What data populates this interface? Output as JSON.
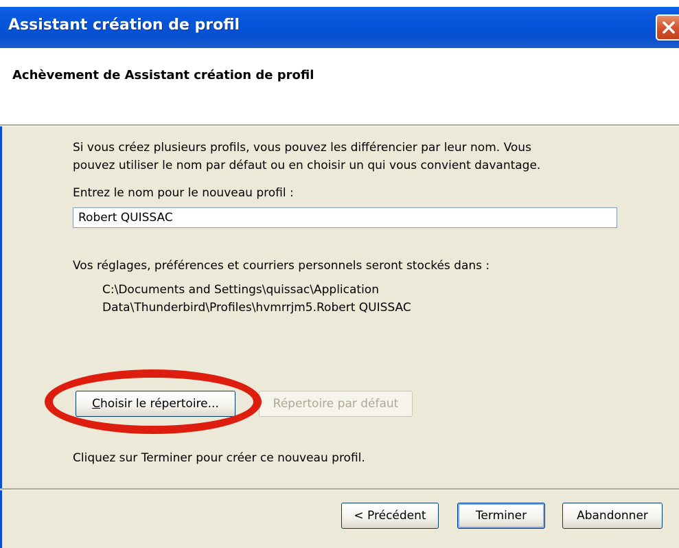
{
  "window": {
    "title": "Assistant création de profil"
  },
  "header": {
    "title": "Achèvement de Assistant création de profil"
  },
  "body": {
    "description_line1": "Si vous créez plusieurs profils, vous pouvez les différencier par leur nom. Vous",
    "description_line2": "pouvez utiliser le nom par défaut ou en choisir un qui vous convient davantage.",
    "name_label": "Entrez le nom pour le nouveau profil :",
    "name_value": "Robert QUISSAC",
    "storage_label": "Vos réglages, préférences et courriers personnels seront stockés dans :",
    "storage_path_line1": "C:\\Documents and Settings\\quissac\\Application",
    "storage_path_line2": "Data\\Thunderbird\\Profiles\\hvmrrjm5.Robert QUISSAC",
    "choose_dir_label_prefix": "C",
    "choose_dir_label_rest": "hoisir le répertoire...",
    "default_dir_label": "Répertoire par défaut",
    "finish_instruction": "Cliquez sur Terminer pour créer ce nouveau profil."
  },
  "footer": {
    "prev_label": "< Précédent",
    "finish_label": "Terminer",
    "cancel_label": "Abandonner"
  },
  "colors": {
    "titlebar": "#0454d9",
    "dialog_bg": "#ece9d8",
    "highlight_ellipse": "#dd1e0f"
  }
}
